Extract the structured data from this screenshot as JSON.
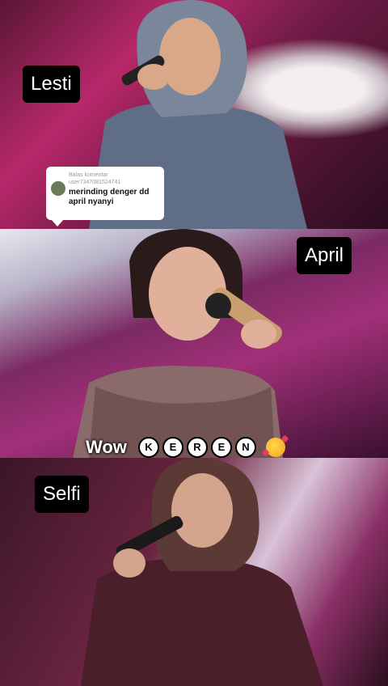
{
  "panels": [
    {
      "label": "Lesti"
    },
    {
      "label": "April"
    },
    {
      "label": "Selfi"
    }
  ],
  "reply_bubble": {
    "header": "Balas komentar",
    "username": "user7347081524741",
    "comment": "merinding denger dd april nyanyi"
  },
  "caption": {
    "prefix": "Wow",
    "letters": [
      "K",
      "E",
      "R",
      "E",
      "N"
    ],
    "emoji": "smiling-face-with-hearts-icon"
  }
}
